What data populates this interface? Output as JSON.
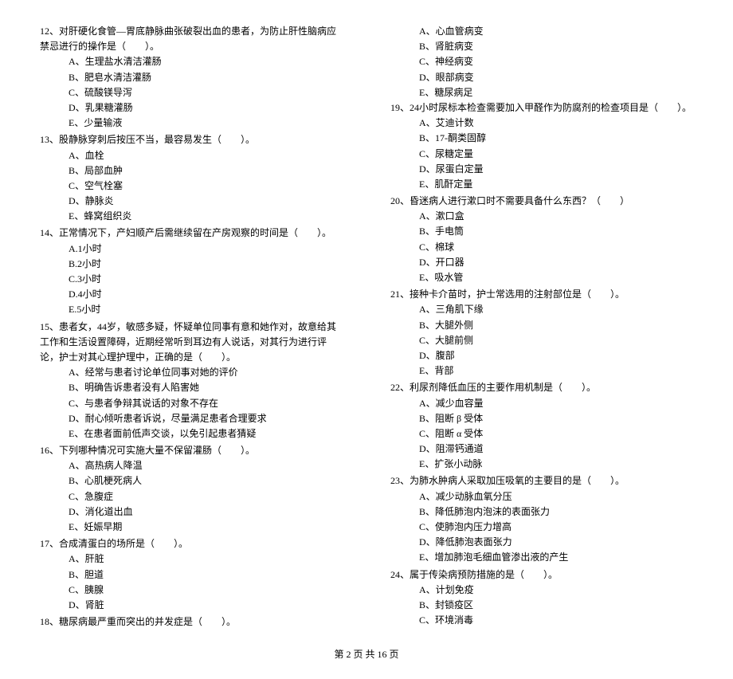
{
  "left": [
    {
      "num": "12、",
      "stem": "对肝硬化食管—胃底静脉曲张破裂出血的患者，为防止肝性脑病应禁忌进行的操作是（　　）。",
      "opts": [
        "A、生理盐水清洁灌肠",
        "B、肥皂水清洁灌肠",
        "C、硫酸镁导泻",
        "D、乳果糖灌肠",
        "E、少量输液"
      ]
    },
    {
      "num": "13、",
      "stem": "股静脉穿刺后按压不当，最容易发生（　　）。",
      "opts": [
        "A、血栓",
        "B、局部血肿",
        "C、空气栓塞",
        "D、静脉炎",
        "E、蜂窝组织炎"
      ]
    },
    {
      "num": "14、",
      "stem": "正常情况下，产妇顺产后需继续留在产房观察的时间是（　　）。",
      "opts": [
        "A.1小时",
        "B.2小时",
        "C.3小时",
        "D.4小时",
        "E.5小时"
      ]
    },
    {
      "num": "15、",
      "stem": "患者女，44岁，敏感多疑，怀疑单位同事有意和她作对，故意给其工作和生活设置障碍，近期经常听到耳边有人说话，对其行为进行评论，护士对其心理护理中，正确的是（　　）。",
      "opts": [
        "A、经常与患者讨论单位同事对她的评价",
        "B、明确告诉患者没有人陷害她",
        "C、与患者争辩其说话的对象不存在",
        "D、耐心倾听患者诉说，尽量满足患者合理要求",
        "E、在患者面前低声交谈，以免引起患者猜疑"
      ]
    },
    {
      "num": "16、",
      "stem": "下列哪种情况可实施大量不保留灌肠（　　）。",
      "opts": [
        "A、高热病人降温",
        "B、心肌梗死病人",
        "C、急腹症",
        "D、消化道出血",
        "E、妊娠早期"
      ]
    },
    {
      "num": "17、",
      "stem": "合成清蛋白的场所是（　　）。",
      "opts": [
        "A、肝脏",
        "B、胆道",
        "C、胰腺",
        "D、肾脏"
      ]
    },
    {
      "num": "18、",
      "stem": "糖尿病最严重而突出的并发症是（　　）。",
      "opts": []
    }
  ],
  "right_pre_opts": [
    "A、心血管病变",
    "B、肾脏病变",
    "C、神经病变",
    "D、眼部病变",
    "E、糖尿病足"
  ],
  "right": [
    {
      "num": "19、",
      "stem": "24小时尿标本检查需要加入甲醛作为防腐剂的检查项目是（　　）。",
      "opts": [
        "A、艾迪计数",
        "B、17-酮类固醇",
        "C、尿糖定量",
        "D、尿蛋白定量",
        "E、肌酐定量"
      ]
    },
    {
      "num": "20、",
      "stem": "昏迷病人进行漱口时不需要具备什么东西？（　　）",
      "opts": [
        "A、漱口盒",
        "B、手电筒",
        "C、棉球",
        "D、开口器",
        "E、吸水管"
      ]
    },
    {
      "num": "21、",
      "stem": "接种卡介苗时，护士常选用的注射部位是（　　）。",
      "opts": [
        "A、三角肌下缘",
        "B、大腿外侧",
        "C、大腿前侧",
        "D、腹部",
        "E、背部"
      ]
    },
    {
      "num": "22、",
      "stem": "利尿剂降低血压的主要作用机制是（　　）。",
      "opts": [
        "A、减少血容量",
        "B、阻断 β 受体",
        "C、阻断 α 受体",
        "D、阻滞钙通道",
        "E、扩张小动脉"
      ]
    },
    {
      "num": "23、",
      "stem": "为肺水肿病人采取加压吸氧的主要目的是（　　）。",
      "opts": [
        "A、减少动脉血氧分压",
        "B、降低肺泡内泡沫的表面张力",
        "C、使肺泡内压力增高",
        "D、降低肺泡表面张力",
        "E、增加肺泡毛细血管渗出液的产生"
      ]
    },
    {
      "num": "24、",
      "stem": "属于传染病预防措施的是（　　）。",
      "opts": [
        "A、计划免疫",
        "B、封锁疫区",
        "C、环境消毒"
      ]
    }
  ],
  "footer": "第 2 页 共 16 页"
}
